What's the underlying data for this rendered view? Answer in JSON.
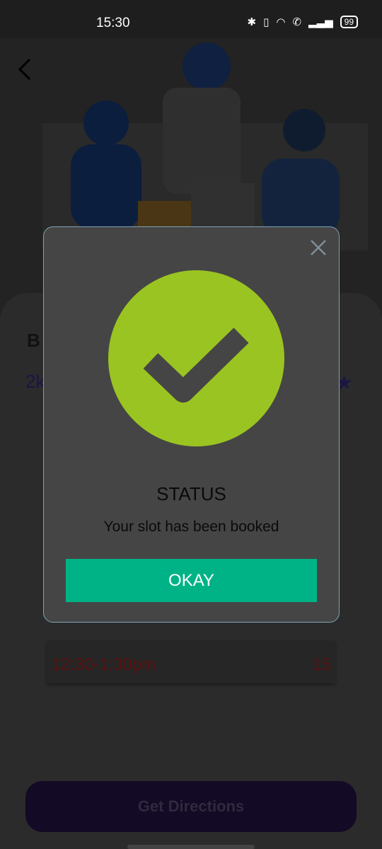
{
  "status_bar": {
    "time": "15:30",
    "battery": "99"
  },
  "background": {
    "partial_title": "B",
    "partial_distance": "2k",
    "rating_icon": "star-icon",
    "slot": {
      "time": "12:30-1:30pm",
      "count": "15"
    },
    "directions_button_label": "Get Directions"
  },
  "dialog": {
    "title": "STATUS",
    "message": "Your slot has been booked",
    "ok_label": "OKAY",
    "icon": "check-circle-icon",
    "colors": {
      "success": "#9ac421",
      "button": "#00b386",
      "panel": "#454545"
    }
  }
}
